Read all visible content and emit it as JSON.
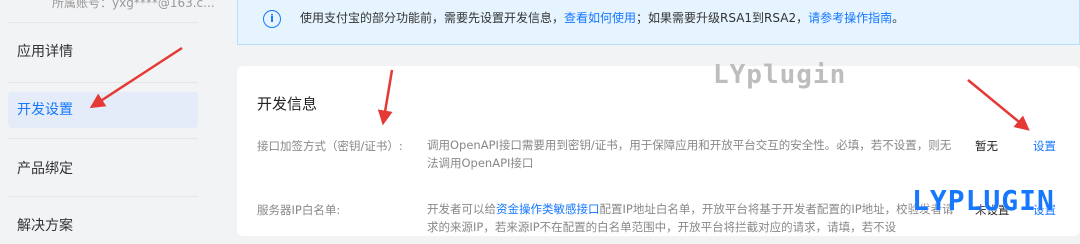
{
  "sidebar": {
    "account": "所属账号：yxg****@163.c...",
    "items": [
      {
        "label": "应用详情"
      },
      {
        "label": "开发设置",
        "active": true
      },
      {
        "label": "产品绑定"
      },
      {
        "label": "解决方案"
      }
    ]
  },
  "notice": {
    "icon": "info-icon",
    "text_before": "使用支付宝的部分功能前，需要先设置开发信息，",
    "link1": "查看如何使用",
    "text_middle": "；如果需要升级RSA1到RSA2，",
    "link2": "请参考操作指南",
    "text_after": "。"
  },
  "panel": {
    "title": "开发信息",
    "rows": [
      {
        "label": "接口加签方式（密钥/证书）:",
        "desc": "调用OpenAPI接口需要用到密钥/证书，用于保障应用和开放平台交互的安全性。必填，若不设置，则无法调用OpenAPI接口",
        "status": "暂无",
        "action": "设置"
      },
      {
        "label": "服务器IP白名单:",
        "desc_before": "开发者可以给",
        "desc_link": "资金操作类敏感接口",
        "desc_after": "配置IP地址白名单，开放平台将基于开发者配置的IP地址，校验发者请求的来源IP，若来源IP不在配置的白名单范围中，开放平台将拦截对应的请求，请填，若不设",
        "status": "未设置",
        "action": "设置"
      }
    ]
  },
  "watermarks": [
    "LYplugin",
    "LYPLUGIN"
  ],
  "colors": {
    "accent": "#1677ff",
    "annotation_arrow": "#e53935",
    "notice_bg": "#e6f4ff"
  }
}
